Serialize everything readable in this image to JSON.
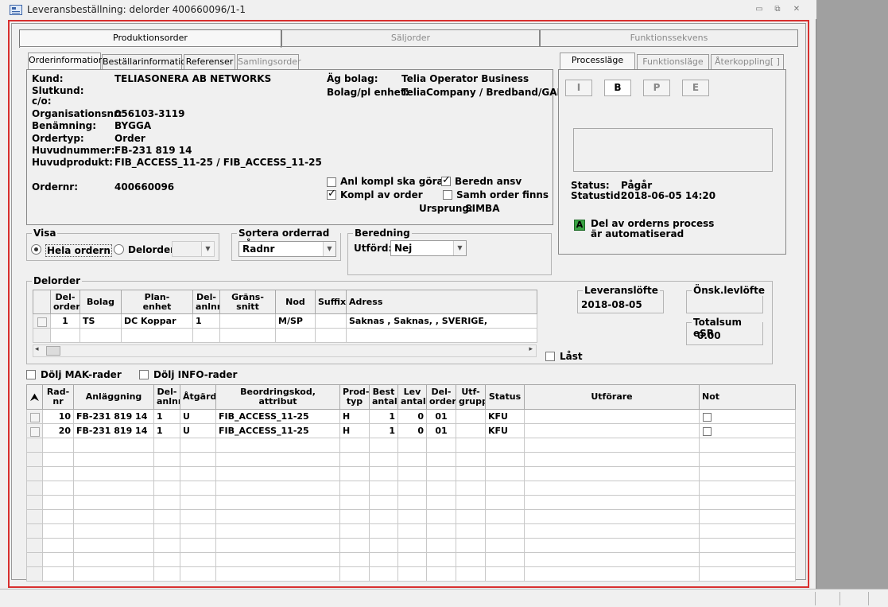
{
  "window": {
    "title": "Leveransbeställning: delorder 400660096/1-1",
    "controls": {
      "minimize": "▭",
      "restore": "⧉",
      "close": "✕"
    }
  },
  "main_tabs": [
    "Produktionsorder",
    "Säljorder",
    "Funktionssekvens"
  ],
  "order_tabs": [
    "Orderinformation",
    "Beställarinformation",
    "Referenser",
    "Samlingsorder"
  ],
  "order_info": {
    "kund_label": "Kund:",
    "kund": "TELIASONERA AB NETWORKS",
    "slutkund_label": "Slutkund:",
    "co_label": "c/o:",
    "orgnr_label": "Organisationsnr:",
    "orgnr": "056103-3119",
    "benamning_label": "Benämning:",
    "benamning": "BYGGA",
    "ordertyp_label": "Ordertyp:",
    "ordertyp": "Order",
    "huvudnummer_label": "Huvudnummer:",
    "huvudnummer": "FB-231 819 14",
    "huvudprodukt_label": "Huvudprodukt:",
    "huvudprodukt": "FIB_ACCESS_11-25 / FIB_ACCESS_11-25",
    "ordernr_label": "Ordernr:",
    "ordernr": "400660096",
    "ag_bolag_label": "Äg bolag:",
    "ag_bolag": "Telia Operator Business",
    "bolag_pl_label": "Bolag/pl enhet:",
    "bolag_pl": "TeliaCompany / Bredband/GAI",
    "cb_anl_kompl": "Anl kompl ska göras",
    "cb_beredn_ansv": "Beredn ansv",
    "cb_kompl_av_order": "Kompl av order",
    "cb_samh_order": "Samh order finns",
    "ursprung_label": "Ursprung:",
    "ursprung": "SIMBA"
  },
  "process_tabs": [
    "Processläge",
    "Funktionsläge",
    "Återkoppling[ ]"
  ],
  "process": {
    "buttons": [
      "I",
      "B",
      "P",
      "E"
    ],
    "status_label": "Status:",
    "status": "Pågår",
    "statustid_label": "Statustid:",
    "statustid": "2018-06-05 14:20",
    "auto_icon_letter": "A",
    "auto_text_1": "Del av orderns process",
    "auto_text_2": "är automatiserad"
  },
  "visa": {
    "label": "Visa",
    "hela_ordern": "Hela ordern",
    "delorder": "Delorder",
    "selected": "Hela ordern"
  },
  "sortera": {
    "label": "Sortera orderrad på",
    "value": "Radnr"
  },
  "beredning": {
    "label": "Beredning",
    "utford_label": "Utförd:",
    "utford_value": "Nej"
  },
  "delorder": {
    "label": "Delorder",
    "columns": [
      "Del-\norder",
      "Bolag",
      "Plan-\nenhet",
      "Del-\nanlnr",
      "Gräns-\nsnitt",
      "Nod",
      "Suffix",
      "Adress"
    ],
    "rows": [
      [
        "1",
        "TS",
        "DC Koppar",
        "1",
        "",
        "M/SP",
        "",
        "Saknas , Saknas, , SVERIGE,"
      ]
    ]
  },
  "leveranslofte": {
    "label": "Leveranslöfte",
    "value": "2018-08-05"
  },
  "onsk_levlofte": {
    "label": "Önsk.levlöfte",
    "value": ""
  },
  "totalsum": {
    "label": "Totalsum eSR",
    "value": "0.00"
  },
  "last_label": "Låst",
  "dolj_mak": "Dölj MAK-rader",
  "dolj_info": "Dölj INFO-rader",
  "orderrows": {
    "sort_icon": "⮝",
    "columns": [
      "Rad-\nnr",
      "Anläggning",
      "Del-\nanlnr",
      "Åtgärd",
      "Beordringskod,\nattribut",
      "Prod-\ntyp",
      "Best\nantal",
      "Lev\nantal",
      "Del-\norder",
      "Utf-\ngrupp",
      "Status",
      "Utförare",
      "Not"
    ],
    "rows": [
      [
        "10",
        "FB-231 819 14",
        "1",
        "U",
        "FIB_ACCESS_11-25",
        "H",
        "1",
        "0",
        "01",
        "",
        "KFU",
        "",
        ""
      ],
      [
        "20",
        "FB-231 819 14",
        "1",
        "U",
        "FIB_ACCESS_11-25",
        "H",
        "1",
        "0",
        "01",
        "",
        "KFU",
        "",
        ""
      ]
    ],
    "empty_rows": 10
  }
}
